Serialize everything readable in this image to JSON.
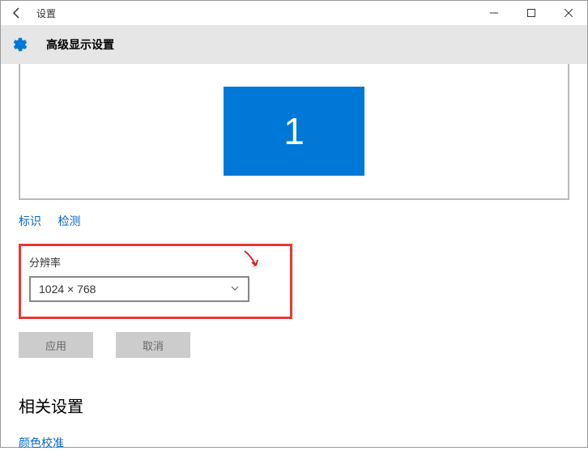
{
  "window": {
    "title": "设置"
  },
  "header": {
    "page_title": "高级显示设置"
  },
  "display": {
    "monitor_number": "1",
    "identify_link": "标识",
    "detect_link": "检测"
  },
  "resolution": {
    "label": "分辨率",
    "selected": "1024 × 768"
  },
  "buttons": {
    "apply": "应用",
    "cancel": "取消"
  },
  "related": {
    "title": "相关设置",
    "color_calibration": "颜色校准"
  }
}
